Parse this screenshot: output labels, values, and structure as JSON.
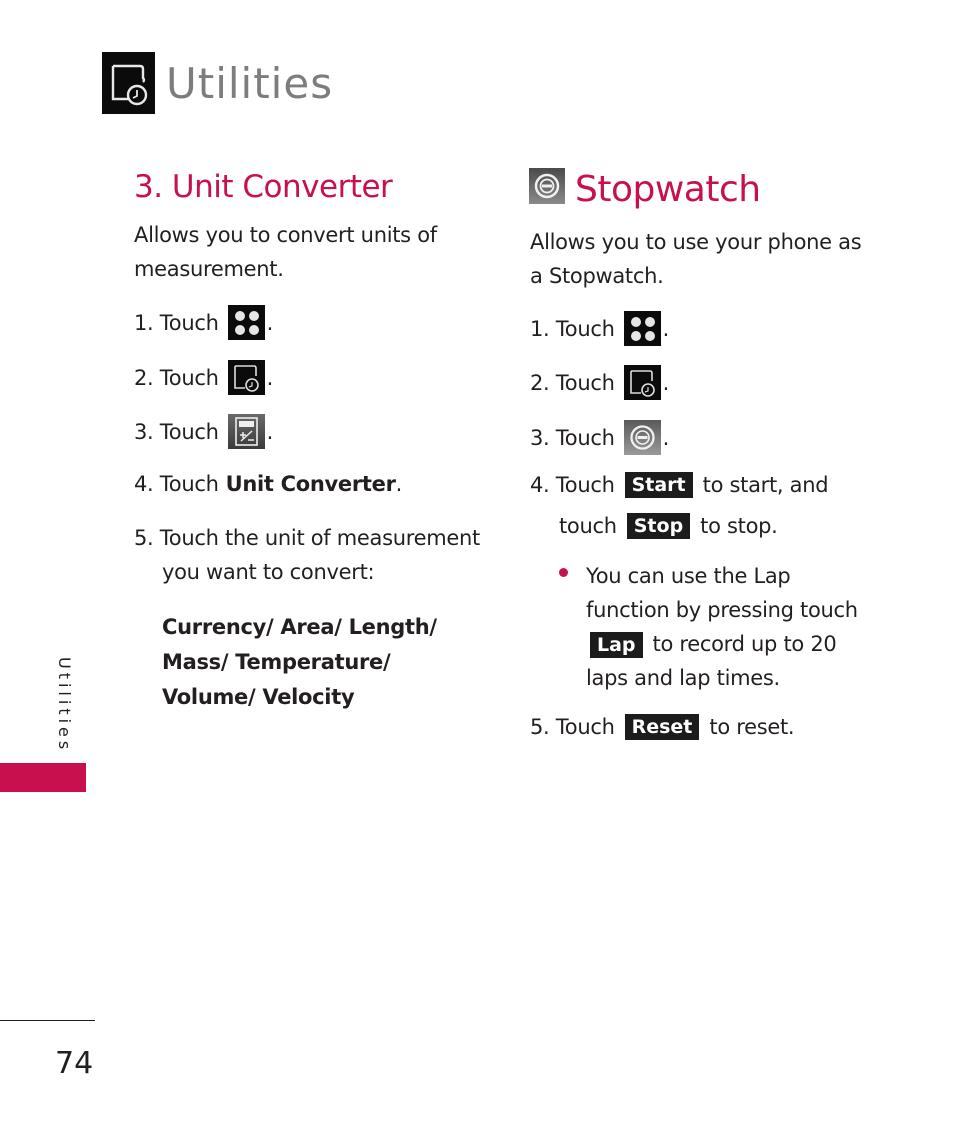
{
  "page": {
    "header_icon": "utilities-clock-icon",
    "title": "Utilities",
    "side_tab_label": "Utilities",
    "page_number": "74",
    "accent_color": "#c8104f"
  },
  "unit_converter": {
    "heading": "3. Unit Converter",
    "intro": "Allows you to convert units of measurement.",
    "steps": [
      {
        "num": "1. Touch",
        "icon": "menu-grid-icon",
        "after": "."
      },
      {
        "num": "2. Touch",
        "icon": "utilities-clock-icon",
        "after": "."
      },
      {
        "num": "3. Touch",
        "icon": "calculator-icon",
        "after": "."
      },
      {
        "num": "4. Touch",
        "bold": "Unit Converter",
        "after": "."
      },
      {
        "num": "5. Touch the unit of measurement",
        "cont": "you want to convert:"
      }
    ],
    "units_line1": "Currency/ Area/ Length/",
    "units_line2": "Mass/ Temperature/",
    "units_line3": "Volume/ Velocity"
  },
  "stopwatch": {
    "heading": "Stopwatch",
    "heading_icon": "stopwatch-icon",
    "intro": "Allows you to use your phone as a Stopwatch.",
    "steps": [
      {
        "num": "1. Touch",
        "icon": "menu-grid-icon",
        "after": "."
      },
      {
        "num": "2. Touch",
        "icon": "utilities-clock-icon",
        "after": "."
      },
      {
        "num": "3. Touch",
        "icon": "stopwatch-icon",
        "after": "."
      },
      {
        "num": "4. Touch",
        "button": "Start",
        "after": "to start, and"
      },
      {
        "num": "touch",
        "button": "Stop",
        "after": "to stop."
      },
      {
        "num": "5. Touch",
        "button": "Reset",
        "after": "to reset."
      }
    ],
    "bullet": {
      "line1": "You can use the Lap",
      "line2": "function by pressing touch",
      "button": "Lap",
      "line3_after": "to record up to 20",
      "line4": "laps and lap times."
    }
  }
}
